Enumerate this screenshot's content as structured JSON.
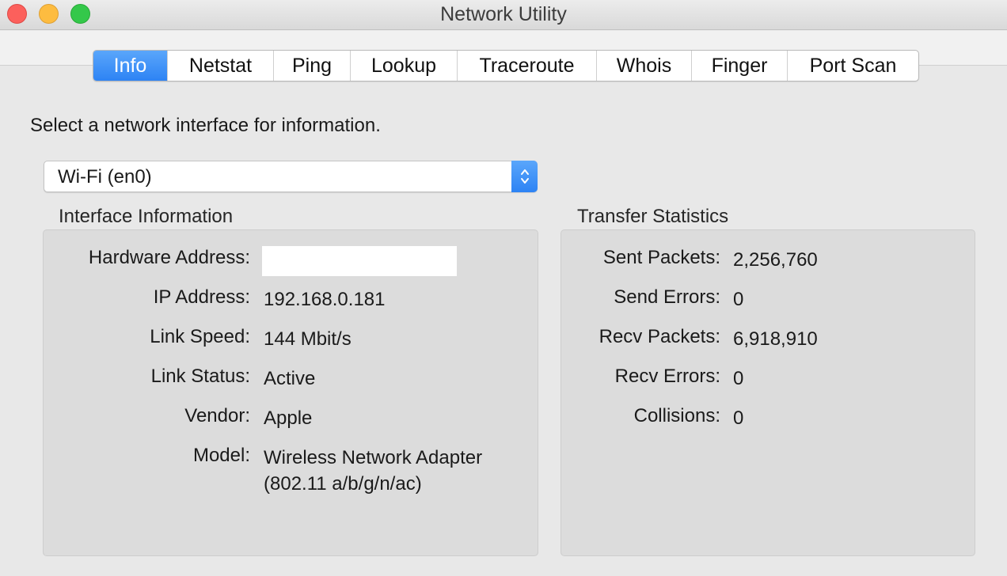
{
  "window": {
    "title": "Network Utility"
  },
  "tabs": [
    {
      "label": "Info",
      "active": true
    },
    {
      "label": "Netstat",
      "active": false
    },
    {
      "label": "Ping",
      "active": false
    },
    {
      "label": "Lookup",
      "active": false
    },
    {
      "label": "Traceroute",
      "active": false
    },
    {
      "label": "Whois",
      "active": false
    },
    {
      "label": "Finger",
      "active": false
    },
    {
      "label": "Port Scan",
      "active": false
    }
  ],
  "info": {
    "prompt": "Select a network interface for information.",
    "interface_select": {
      "selected": "Wi-Fi (en0)",
      "icon": "updown-chevron-icon"
    },
    "interface_information": {
      "title": "Interface Information",
      "hardware_address_label": "Hardware Address:",
      "hardware_address_value": "",
      "ip_address_label": "IP Address:",
      "ip_address_value": "192.168.0.181",
      "link_speed_label": "Link Speed:",
      "link_speed_value": "144 Mbit/s",
      "link_status_label": "Link Status:",
      "link_status_value": "Active",
      "vendor_label": "Vendor:",
      "vendor_value": "Apple",
      "model_label": "Model:",
      "model_value_line1": "Wireless Network Adapter",
      "model_value_line2": "(802.11 a/b/g/n/ac)"
    },
    "transfer_statistics": {
      "title": "Transfer Statistics",
      "sent_packets_label": "Sent Packets:",
      "sent_packets_value": "2,256,760",
      "send_errors_label": "Send Errors:",
      "send_errors_value": "0",
      "recv_packets_label": "Recv Packets:",
      "recv_packets_value": "6,918,910",
      "recv_errors_label": "Recv Errors:",
      "recv_errors_value": "0",
      "collisions_label": "Collisions:",
      "collisions_value": "0"
    }
  },
  "colors": {
    "accent": "#2d83f4",
    "window_background": "#e8e8e8",
    "groupbox_background": "#dcdcdc",
    "close_button": "#fc605c",
    "minimize_button": "#fdbc40",
    "zoom_button": "#34c84a"
  }
}
